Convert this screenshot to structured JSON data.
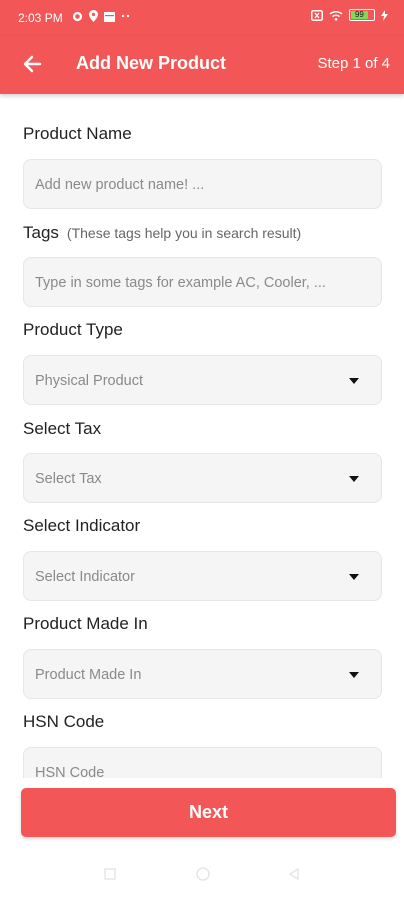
{
  "status_bar": {
    "time": "2:03 PM",
    "battery_level": "99",
    "icons": [
      "whatsapp-icon",
      "location-icon",
      "calendar-icon",
      "more-icon",
      "sim-icon",
      "wifi-icon",
      "battery-icon",
      "charging-icon"
    ]
  },
  "app_bar": {
    "title": "Add New Product",
    "step": "Step 1 of 4",
    "back_icon": "arrow-left-icon"
  },
  "form": {
    "product_name": {
      "label": "Product Name",
      "placeholder": "Add new product name! ..."
    },
    "tags": {
      "label": "Tags",
      "hint": "(These tags help you in search result)",
      "placeholder": "Type in some tags for example AC, Cooler, ..."
    },
    "product_type": {
      "label": "Product Type",
      "value": "Physical Product"
    },
    "select_tax": {
      "label": "Select Tax",
      "value": "Select Tax"
    },
    "select_indicator": {
      "label": "Select Indicator",
      "value": "Select Indicator"
    },
    "made_in": {
      "label": "Product Made In",
      "value": "Product Made In"
    },
    "hsn_code": {
      "label": "HSN Code",
      "placeholder": "HSN Code"
    }
  },
  "next_button": "Next",
  "nav_bar": {
    "icons": [
      "recents-icon",
      "home-icon",
      "back-icon"
    ]
  },
  "colors": {
    "primary": "#f25656",
    "field_bg": "#f5f5f5"
  }
}
